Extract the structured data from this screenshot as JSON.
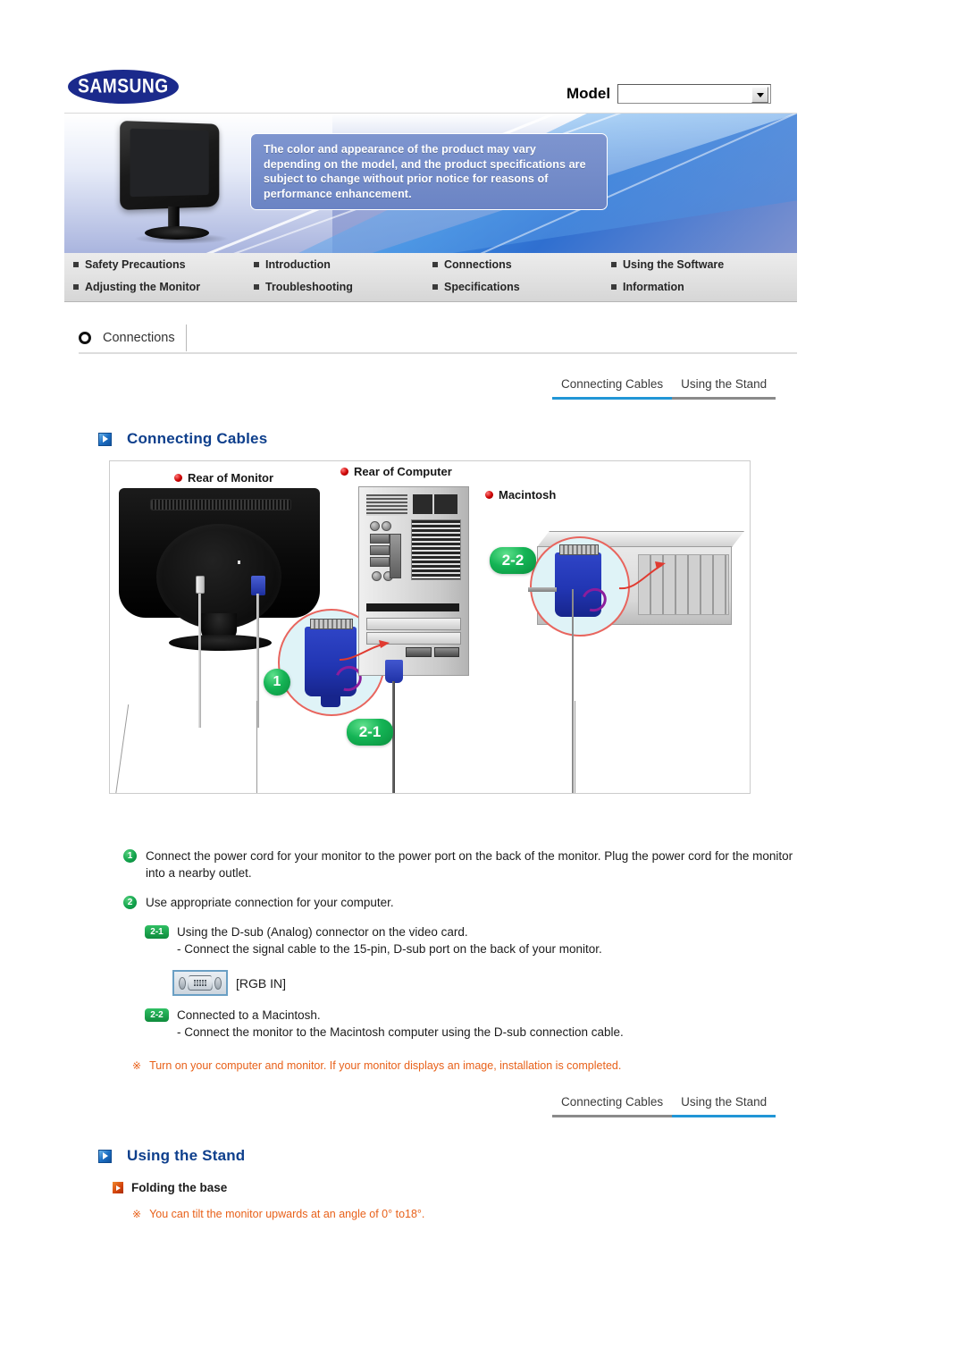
{
  "brand": {
    "logo_text": "SAMSUNG"
  },
  "model_selector": {
    "label": "Model",
    "value": "",
    "icon": "chevron-down-icon"
  },
  "banner": {
    "notice": "The color and appearance of the product may vary depending on the model, and the product specifications are subject to change without prior notice for reasons of performance enhancement."
  },
  "nav": {
    "row1": [
      {
        "label": "Safety Precautions"
      },
      {
        "label": "Introduction"
      },
      {
        "label": "Connections"
      },
      {
        "label": "Using the Software"
      }
    ],
    "row2": [
      {
        "label": "Adjusting the Monitor"
      },
      {
        "label": "Troubleshooting"
      },
      {
        "label": "Specifications"
      },
      {
        "label": "Information"
      }
    ]
  },
  "section": {
    "tab_label": "Connections",
    "icon": "circle-icon"
  },
  "tabs_top": [
    {
      "label": "Connecting Cables",
      "active": true
    },
    {
      "label": "Using the Stand",
      "active": false
    }
  ],
  "tabs_bottom": [
    {
      "label": "Connecting Cables",
      "active": false
    },
    {
      "label": "Using the Stand",
      "active": true
    }
  ],
  "connecting_cables": {
    "heading": "Connecting Cables",
    "diagram": {
      "labels": [
        {
          "text": "Rear of Monitor"
        },
        {
          "text": "Rear of Computer"
        },
        {
          "text": "Macintosh"
        }
      ],
      "badges": [
        {
          "text": "1"
        },
        {
          "text": "2-1"
        },
        {
          "text": "2-2"
        }
      ]
    },
    "steps": [
      {
        "num": "1",
        "text": "Connect the power cord for your monitor to the power port on the back of the monitor. Plug the power cord for the monitor into a nearby outlet."
      },
      {
        "num": "2",
        "text": "Use appropriate connection for your computer."
      }
    ],
    "substeps": [
      {
        "badge": "2-1",
        "line1": "Using the D-sub (Analog) connector on the video card.",
        "line2": "- Connect the signal cable to the 15-pin, D-sub port on the back of your monitor."
      },
      {
        "badge": "2-2",
        "line1": "Connected to a Macintosh.",
        "line2": "- Connect the monitor to the Macintosh computer using the D-sub connection cable."
      }
    ],
    "rgb": {
      "icon": "vga-connector-icon",
      "label": "[RGB IN]"
    },
    "note": {
      "mark": "※",
      "text": "Turn on your computer and monitor. If your monitor displays an image, installation is completed."
    }
  },
  "using_the_stand": {
    "heading": "Using the Stand",
    "subheading": "Folding the base",
    "note": {
      "mark": "※",
      "text": "You can tilt the monitor upwards at an angle of 0° to18°."
    }
  },
  "colors": {
    "heading_blue": "#0e3f8c",
    "tab_active": "#2196d6",
    "tab_inactive": "#8a8a8a",
    "note_orange": "#e8611a",
    "badge_green": "#12a44c",
    "samsung_blue": "#1b2a8c"
  }
}
